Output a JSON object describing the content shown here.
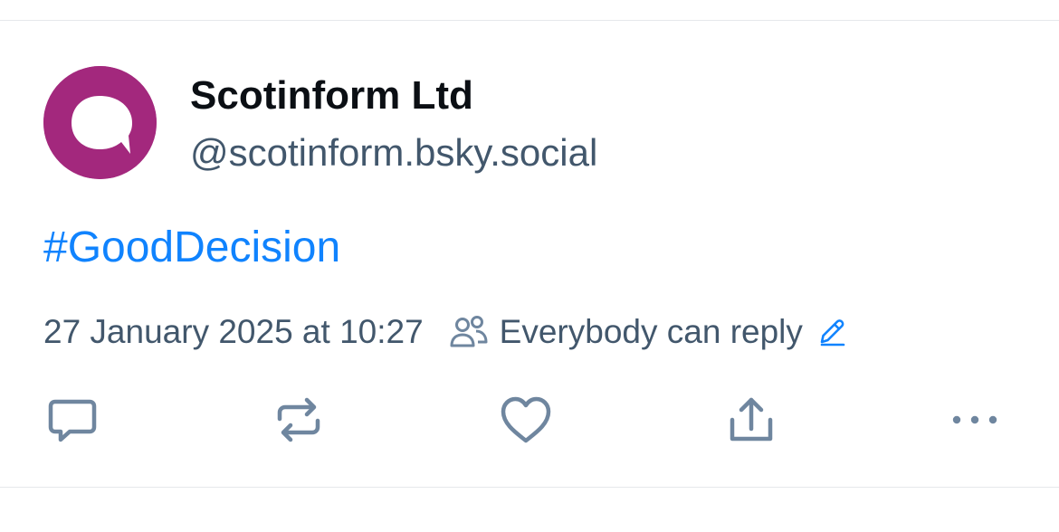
{
  "post": {
    "author": {
      "display_name": "Scotinform Ltd",
      "handle": "@scotinform.bsky.social",
      "avatar_color": "#a3287d",
      "avatar_icon": "speech-bubble-logo"
    },
    "text": "#GoodDecision",
    "timestamp": "27 January 2025 at 10:27",
    "reply_setting": "Everybody can reply",
    "actions": [
      {
        "name": "reply",
        "icon": "speech-bubble-icon"
      },
      {
        "name": "repost",
        "icon": "repost-icon"
      },
      {
        "name": "like",
        "icon": "heart-icon"
      },
      {
        "name": "share",
        "icon": "share-icon"
      },
      {
        "name": "more",
        "icon": "more-icon"
      }
    ]
  },
  "colors": {
    "link": "#1083fe",
    "muted": "#42576c",
    "text": "#0b0f14",
    "icon": "#6f869f"
  }
}
